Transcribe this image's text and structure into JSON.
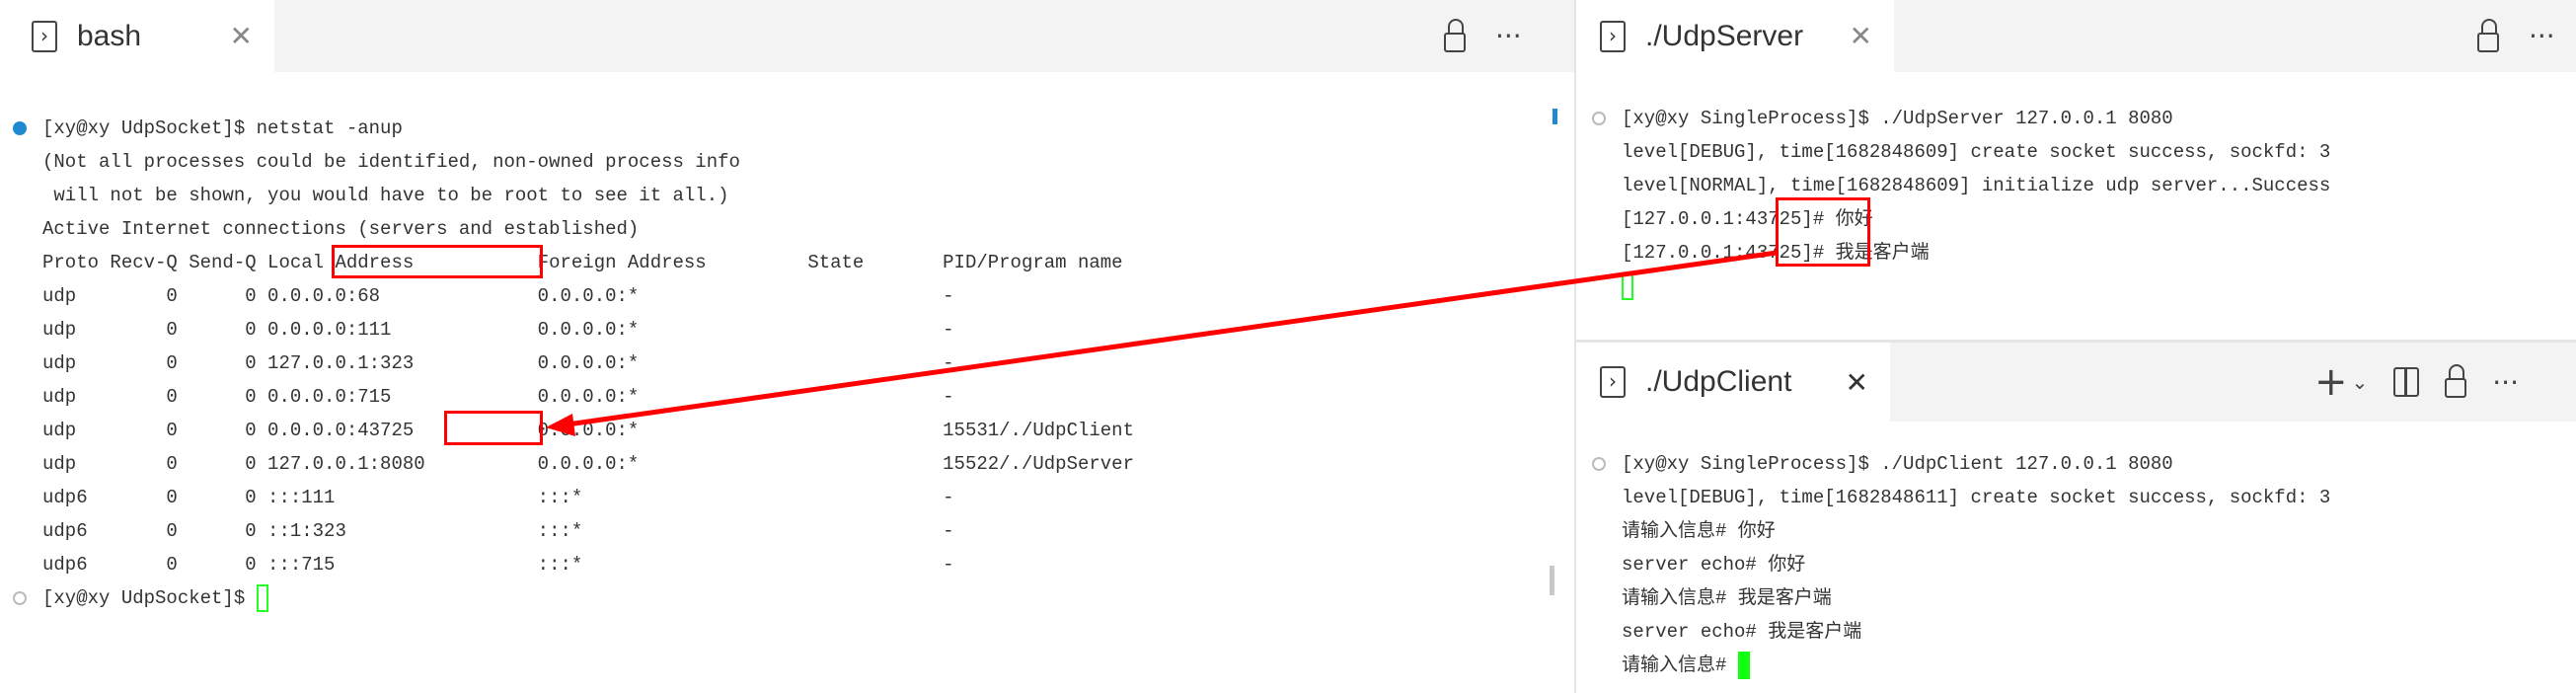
{
  "left_pane": {
    "tab": {
      "label": "bash",
      "icon": "terminal-icon",
      "close": "✕"
    },
    "actions": {
      "lock": "lock-icon",
      "more": "···"
    },
    "lines": [
      "[xy@xy UdpSocket]$ netstat -anup",
      "(Not all processes could be identified, non-owned process info",
      " will not be shown, you would have to be root to see it all.)",
      "Active Internet connections (servers and established)",
      "Proto Recv-Q Send-Q Local Address           Foreign Address         State       PID/Program name",
      "udp        0      0 0.0.0.0:68              0.0.0.0:*                           -",
      "udp        0      0 0.0.0.0:111             0.0.0.0:*                           -",
      "udp        0      0 127.0.0.1:323           0.0.0.0:*                           -",
      "udp        0      0 0.0.0.0:715             0.0.0.0:*                           -",
      "udp        0      0 0.0.0.0:43725           0.0.0.0:*                           15531/./UdpClient",
      "udp        0      0 127.0.0.1:8080          0.0.0.0:*                           15522/./UdpServer",
      "udp6       0      0 :::111                  :::*                                -",
      "udp6       0      0 ::1:323                 :::*                                -",
      "udp6       0      0 :::715                  :::*                                -",
      "[xy@xy UdpSocket]$ "
    ]
  },
  "server_pane": {
    "tab": {
      "label": "./UdpServer",
      "icon": "terminal-icon",
      "close": "✕"
    },
    "actions": {
      "lock": "lock-icon",
      "more": "···"
    },
    "lines": [
      "[xy@xy SingleProcess]$ ./UdpServer 127.0.0.1 8080",
      "level[DEBUG], time[1682848609] create socket success, sockfd: 3",
      "level[NORMAL], time[1682848609] initialize udp server...Success",
      "[127.0.0.1:43725]# 你好",
      "[127.0.0.1:43725]# 我是客户端"
    ]
  },
  "client_pane": {
    "tab": {
      "label": "./UdpClient",
      "icon": "terminal-icon",
      "close": "✕"
    },
    "actions": {
      "add": "+",
      "dropdown": "⌄",
      "split": "split-icon",
      "lock": "lock-icon",
      "more": "···"
    },
    "lines": [
      "[xy@xy SingleProcess]$ ./UdpClient 127.0.0.1 8080",
      "level[DEBUG], time[1682848611] create socket success, sockfd: 3",
      "请输入信息# 你好",
      "server echo# 你好",
      "请输入信息# 我是客户端",
      "server echo# 我是客户端",
      "请输入信息# "
    ]
  },
  "colors": {
    "annotation": "#ff0000",
    "cursor": "#22ff22",
    "accent": "#1f8ad2"
  }
}
